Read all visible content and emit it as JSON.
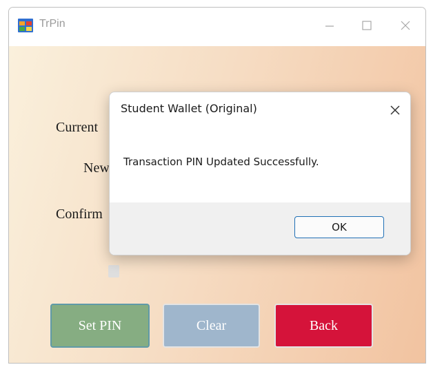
{
  "window": {
    "title": "TrPin",
    "icon": "windows-form-icon",
    "controls": [
      "minimize-icon",
      "maximize-icon",
      "close-icon"
    ]
  },
  "form": {
    "labels": {
      "current": "Current",
      "new": "New",
      "confirm": "Confirm"
    },
    "buttons": {
      "set_pin": "Set PIN",
      "clear": "Clear",
      "back": "Back"
    }
  },
  "dialog": {
    "title": "Student Wallet (Original)",
    "message": "Transaction PIN Updated Successfully.",
    "ok_label": "OK"
  },
  "colors": {
    "set_pin_button": "#86ad82",
    "clear_button": "#9fb6cc",
    "back_button": "#d5133a",
    "ok_border": "#1f6fb5"
  }
}
